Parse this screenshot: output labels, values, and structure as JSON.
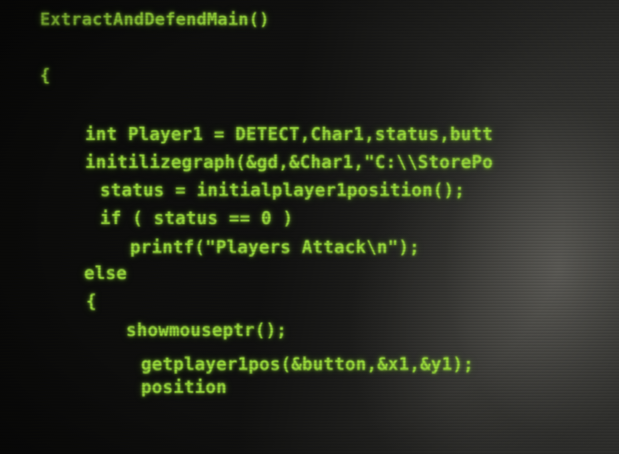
{
  "code": {
    "lines": [
      "ExtractAndDefendMain()",
      "{",
      "int Player1 = DETECT,Char1,status,butt",
      "initilizegraph(&gd,&Char1,\"C:\\\\StorePo",
      "status = initialplayer1position();",
      "if ( status == 0 )",
      "printf(\"Players Attack\\n\");",
      "else",
      "{",
      "showmouseptr();",
      "getplayer1pos(&button,&x1,&y1);",
      "position"
    ]
  },
  "colors": {
    "code_text": "#9bdc3c",
    "background": "#0b0b0a"
  }
}
